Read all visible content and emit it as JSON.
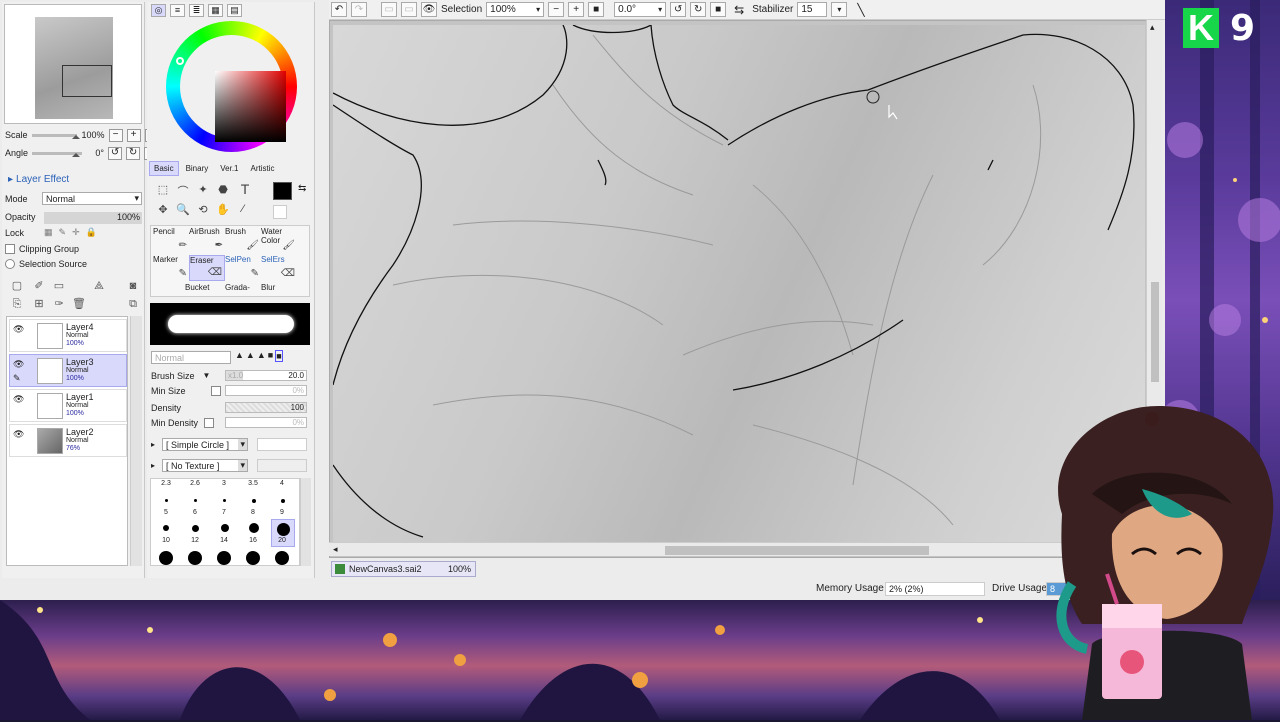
{
  "navigator": {
    "scale_label": "Scale",
    "scale_value": "100%",
    "angle_label": "Angle",
    "angle_value": "0°"
  },
  "layer_panel": {
    "section_title": "Layer Effect",
    "mode_label": "Mode",
    "mode_value": "Normal",
    "opacity_label": "Opacity",
    "opacity_value": "100%",
    "lock_label": "Lock",
    "clipping_label": "Clipping Group",
    "selection_source_label": "Selection Source",
    "layers": [
      {
        "name": "Layer4",
        "mode": "Normal",
        "opacity": "100%",
        "selected": false
      },
      {
        "name": "Layer3",
        "mode": "Normal",
        "opacity": "100%",
        "selected": true
      },
      {
        "name": "Layer1",
        "mode": "Normal",
        "opacity": "100%",
        "selected": false
      },
      {
        "name": "Layer2",
        "mode": "Normal",
        "opacity": "76%",
        "selected": false
      }
    ]
  },
  "tool_panel": {
    "tabs": [
      "Basic",
      "Binary",
      "Ver.1",
      "Artistic"
    ],
    "brushes": [
      "Pencil",
      "AirBrush",
      "Brush",
      "Water Color",
      "Marker",
      "Eraser",
      "SelPen",
      "SelErs",
      "Bucket",
      "Grada-",
      "Blur"
    ],
    "blend_mode": "Normal",
    "brush_size_label": "Brush Size",
    "brush_size_mult": "x1.0",
    "brush_size_value": "20.0",
    "min_size_label": "Min Size",
    "min_size_value": "0%",
    "density_label": "Density",
    "density_value": "100",
    "min_density_label": "Min Density",
    "min_density_value": "0%",
    "shape_value": "[ Simple Circle ]",
    "texture_value": "[ No Texture ]",
    "size_labels": [
      "2.3",
      "2.6",
      "3",
      "3.5",
      "4",
      "5",
      "6",
      "7",
      "8",
      "9",
      "10",
      "12",
      "14",
      "16",
      "20"
    ]
  },
  "toolbar": {
    "selection_label": "Selection",
    "zoom_value": "100%",
    "angle_value": "0.0°",
    "stabilizer_label": "Stabilizer",
    "stabilizer_value": "15"
  },
  "canvas": {
    "file_name": "NewCanvas3.sai2",
    "file_zoom": "100%"
  },
  "status": {
    "memory_label": "Memory Usage",
    "memory_value": "2% (2%)",
    "drive_label": "Drive Usage",
    "drive_value": "8"
  },
  "overlay": {
    "logo_letter": "K",
    "logo_number": "9"
  },
  "colors": {
    "accent": "#2b62b8",
    "selected": "#d9d9fb",
    "logo_green": "#17d64a"
  }
}
